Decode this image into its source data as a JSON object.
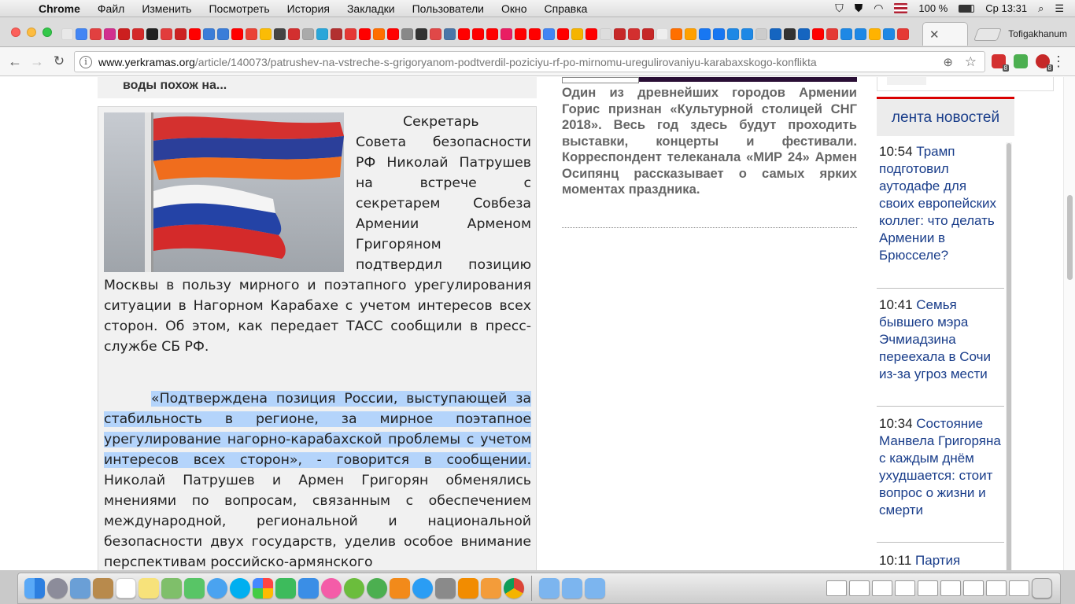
{
  "menubar": {
    "app_name": "Chrome",
    "items": [
      "Файл",
      "Изменить",
      "Посмотреть",
      "История",
      "Закладки",
      "Пользователи",
      "Окно",
      "Справка"
    ],
    "battery": "100 %",
    "clock": "Ср 13:31"
  },
  "browser": {
    "profile_name": "Tofigakhanum",
    "url_domain": "www.yerkramas.org",
    "url_path": "/article/140073/patrushev-na-vstreche-s-grigoryanom-podtverdil-poziciyu-rf-po-mirnomu-uregulirovaniyu-karabaxskogo-konflikta",
    "extension_badges": [
      "8",
      "8"
    ],
    "active_tab_icon": "G"
  },
  "page": {
    "prev_teaser": "воды похож на...",
    "article_lead": "Секретарь Совета безопасности РФ Николай Патрушев на встрече с секретарем Совбеза Армении Арменом Григоряном подтвердил позицию Москвы в пользу мирного и поэтапного урегулирования ситуации в Нагорном Карабахе с учетом интересов всех сторон. Об этом, как передает ТАСС сообщили в пресс-службе СБ РФ.",
    "article_quote": "«Подтверждена позиция России, выступающей за стабильность в регионе, за мирное поэтапное урегулирование нагорно-карабахской проблемы с учетом интересов всех сторон», - говорится в сообщении.",
    "article_continuation": " Николай Патрушев и Армен Григорян обменялись мнениями по вопросам, связанным с обеспечением международной, региональной и национальной безопасности двух государств, уделив особое внимание перспективам российско-армянского",
    "middle_description": "Один из древнейших городов Армении Горис признан «Культурной столицей СНГ 2018». Весь год здесь будут проходить выставки, концерты и фестивали. Корреспондент телеканала «МИР 24» Армен Осипянц рассказывает о самых ярких моментах праздника.",
    "news_feed": {
      "title": "лента новостей",
      "items": [
        {
          "time": "10:54",
          "title": "Трамп подготовил аутодафе для своих европейских коллег: что делать Армении в Брюсселе?"
        },
        {
          "time": "10:41",
          "title": "Семья бывшего мэра Эчмиадзина переехала в Сочи из-за угроз мести"
        },
        {
          "time": "10:34",
          "title": "Состояние Манвела Григоряна с каждым днём ухудшается: стоит вопрос о жизни и смерти"
        },
        {
          "time": "10:11",
          "title": "Партия"
        }
      ]
    }
  },
  "colors": {
    "link_blue": "#193d8a",
    "feed_accent_red": "#d90000",
    "selection": "#b4d4fb"
  }
}
